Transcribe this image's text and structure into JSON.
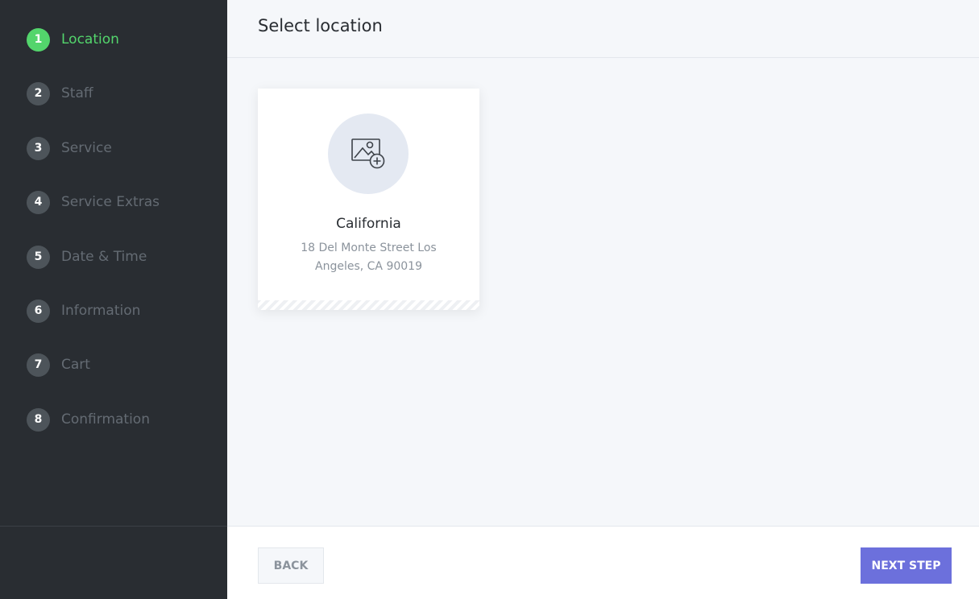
{
  "sidebar": {
    "steps": [
      {
        "number": "1",
        "label": "Location",
        "active": true
      },
      {
        "number": "2",
        "label": "Staff"
      },
      {
        "number": "3",
        "label": "Service"
      },
      {
        "number": "4",
        "label": "Service Extras"
      },
      {
        "number": "5",
        "label": "Date & Time"
      },
      {
        "number": "6",
        "label": "Information"
      },
      {
        "number": "7",
        "label": "Cart"
      },
      {
        "number": "8",
        "label": "Confirmation"
      }
    ]
  },
  "header": {
    "title": "Select location"
  },
  "locations": [
    {
      "name": "California",
      "address": "18 Del Monte Street Los Angeles, CA 90019",
      "image_icon": "image-add-icon"
    }
  ],
  "footer": {
    "back_label": "BACK",
    "next_label": "NEXT STEP"
  },
  "colors": {
    "sidebar_bg": "#292d32",
    "active_step": "#53d56c",
    "inactive_step": "#4d545a",
    "primary_button": "#6c70dc",
    "content_bg": "#f5f7fa"
  }
}
